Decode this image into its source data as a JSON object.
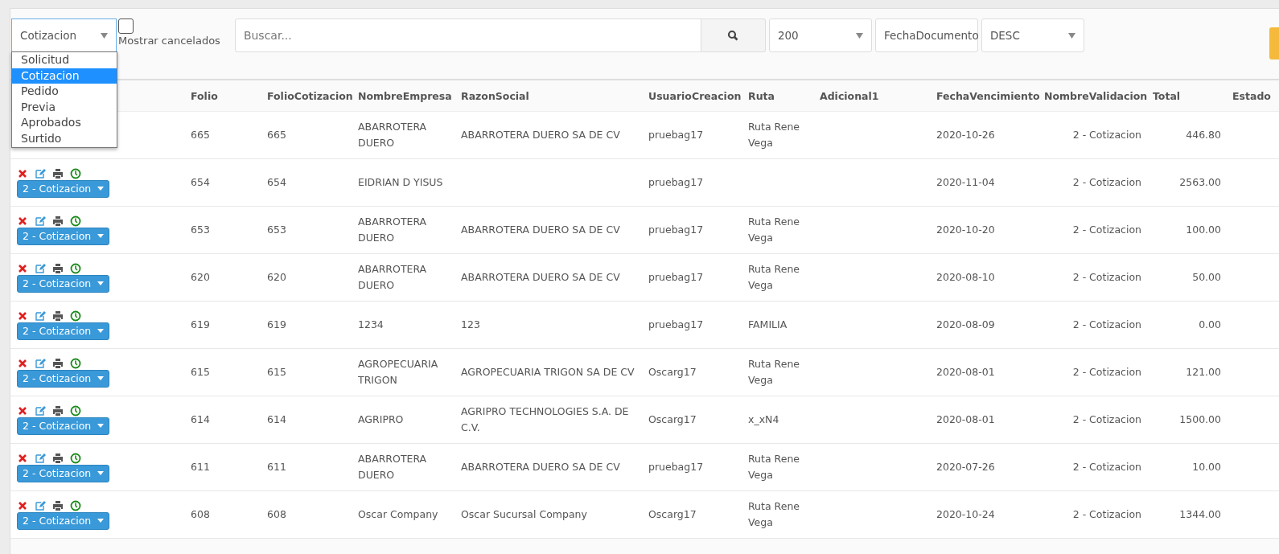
{
  "toolbar": {
    "type_select": {
      "value": "Cotizacion",
      "open": true,
      "options": [
        {
          "label": "Solicitud",
          "selected": false
        },
        {
          "label": "Cotizacion",
          "selected": true
        },
        {
          "label": "Pedido",
          "selected": false
        },
        {
          "label": "Previa",
          "selected": false
        },
        {
          "label": "Aprobados",
          "selected": false
        },
        {
          "label": "Surtido",
          "selected": false
        }
      ]
    },
    "show_cancelled": {
      "label": "Mostrar cancelados",
      "checked": false
    },
    "search": {
      "placeholder": "Buscar..."
    },
    "page_size": "200",
    "order_field": "FechaDocumento",
    "order_dir": "DESC"
  },
  "table": {
    "columns": [
      "",
      "Folio",
      "FolioCotizacion",
      "NombreEmpresa",
      "RazonSocial",
      "UsuarioCreacion",
      "Ruta",
      "Adicional1",
      "FechaVencimiento",
      "NombreValidacion",
      "Total",
      "Estado"
    ],
    "rows": [
      {
        "cells": [
          "",
          "665",
          "665",
          "ABARROTERA DUERO",
          "ABARROTERA DUERO SA DE CV",
          "pruebag17",
          "Ruta Rene Vega",
          "",
          "2020-10-26",
          "2 - Cotizacion",
          "446.80",
          ""
        ]
      },
      {
        "status": "2 - Cotizacion",
        "cells": [
          "",
          "654",
          "654",
          "EIDRIAN D YISUS",
          "",
          "pruebag17",
          "",
          "",
          "2020-11-04",
          "2 - Cotizacion",
          "2563.00",
          ""
        ]
      },
      {
        "status": "2 - Cotizacion",
        "cells": [
          "",
          "653",
          "653",
          "ABARROTERA DUERO",
          "ABARROTERA DUERO SA DE CV",
          "pruebag17",
          "Ruta Rene Vega",
          "",
          "2020-10-20",
          "2 - Cotizacion",
          "100.00",
          ""
        ]
      },
      {
        "status": "2 - Cotizacion",
        "cells": [
          "",
          "620",
          "620",
          "ABARROTERA DUERO",
          "ABARROTERA DUERO SA DE CV",
          "pruebag17",
          "Ruta Rene Vega",
          "",
          "2020-08-10",
          "2 - Cotizacion",
          "50.00",
          ""
        ]
      },
      {
        "status": "2 - Cotizacion",
        "cells": [
          "",
          "619",
          "619",
          "1234",
          "123",
          "pruebag17",
          "FAMILIA",
          "",
          "2020-08-09",
          "2 - Cotizacion",
          "0.00",
          ""
        ]
      },
      {
        "status": "2 - Cotizacion",
        "cells": [
          "",
          "615",
          "615",
          "AGROPECUARIA TRIGON",
          "AGROPECUARIA TRIGON SA DE CV",
          "Oscarg17",
          "Ruta Rene Vega",
          "",
          "2020-08-01",
          "2 - Cotizacion",
          "121.00",
          ""
        ]
      },
      {
        "status": "2 - Cotizacion",
        "cells": [
          "",
          "614",
          "614",
          "AGRIPRO",
          "AGRIPRO TECHNOLOGIES S.A. DE C.V.",
          "Oscarg17",
          "x_xN4",
          "",
          "2020-08-01",
          "2 - Cotizacion",
          "1500.00",
          ""
        ]
      },
      {
        "status": "2 - Cotizacion",
        "cells": [
          "",
          "611",
          "611",
          "ABARROTERA DUERO",
          "ABARROTERA DUERO SA DE CV",
          "pruebag17",
          "Ruta Rene Vega",
          "",
          "2020-07-26",
          "2 - Cotizacion",
          "10.00",
          ""
        ]
      },
      {
        "status": "2 - Cotizacion",
        "cells": [
          "",
          "608",
          "608",
          "Oscar Company",
          "Oscar Sucursal Company",
          "Oscarg17",
          "Ruta Rene Vega",
          "",
          "2020-10-24",
          "2 - Cotizacion",
          "1344.00",
          ""
        ]
      }
    ]
  }
}
